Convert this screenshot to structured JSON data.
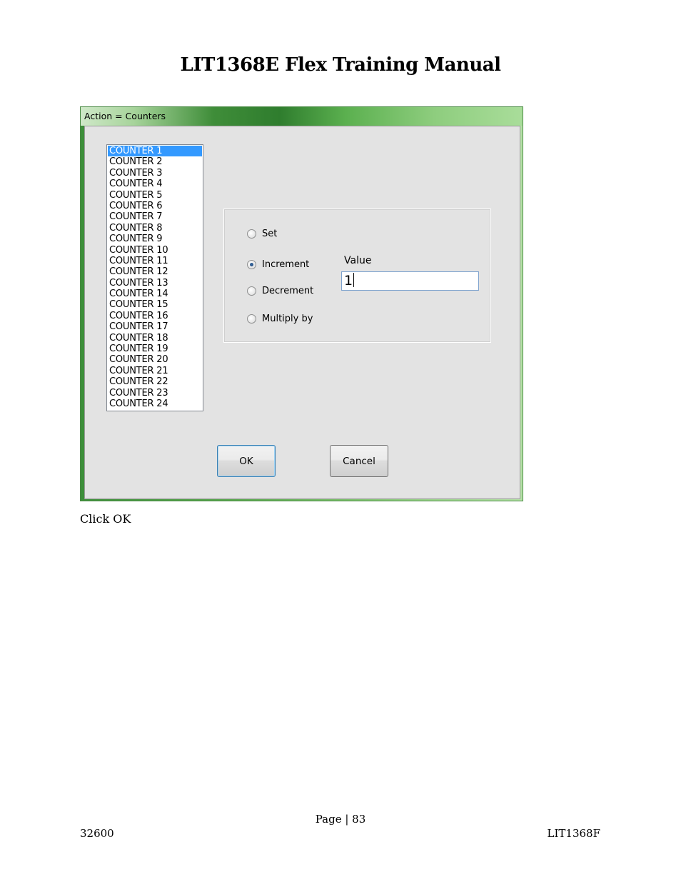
{
  "document": {
    "title": "LIT1368E Flex Training Manual",
    "caption": "Click OK",
    "footer": {
      "page_label": "Page | 83",
      "left": "32600",
      "right": "LIT1368F"
    }
  },
  "dialog": {
    "title": "Action = Counters",
    "counters": [
      "COUNTER 1",
      "COUNTER 2",
      "COUNTER 3",
      "COUNTER 4",
      "COUNTER 5",
      "COUNTER 6",
      "COUNTER 7",
      "COUNTER 8",
      "COUNTER 9",
      "COUNTER 10",
      "COUNTER 11",
      "COUNTER 12",
      "COUNTER 13",
      "COUNTER 14",
      "COUNTER 15",
      "COUNTER 16",
      "COUNTER 17",
      "COUNTER 18",
      "COUNTER 19",
      "COUNTER 20",
      "COUNTER 21",
      "COUNTER 22",
      "COUNTER 23",
      "COUNTER 24"
    ],
    "selected_counter": "COUNTER 1",
    "operations": [
      {
        "label": "Set",
        "checked": false
      },
      {
        "label": "Increment",
        "checked": true
      },
      {
        "label": "Decrement",
        "checked": false
      },
      {
        "label": "Multiply by",
        "checked": false
      }
    ],
    "value_label": "Value",
    "value": "1",
    "ok_label": "OK",
    "cancel_label": "Cancel"
  }
}
